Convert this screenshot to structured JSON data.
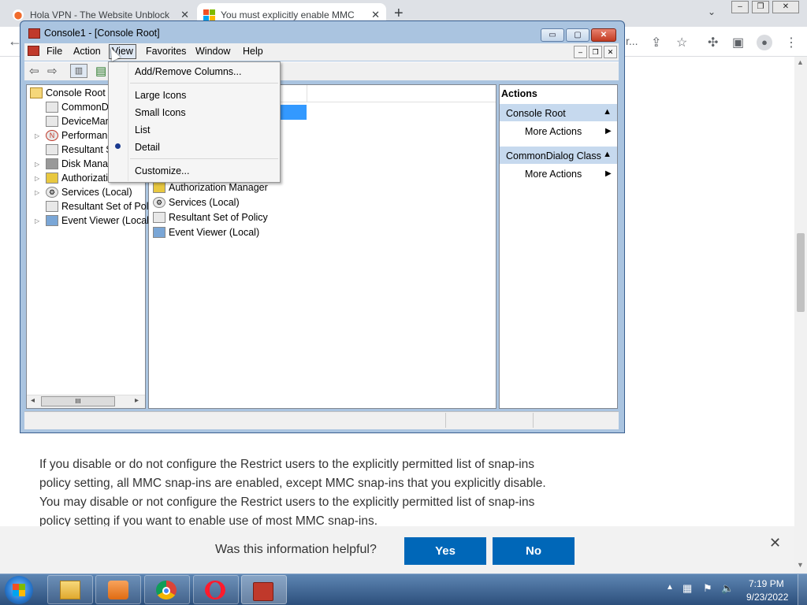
{
  "browser": {
    "tabs": [
      {
        "title": "Hola VPN - The Website Unblock",
        "close": "✕"
      },
      {
        "title": "You must explicitly enable MMC",
        "close": "✕"
      }
    ],
    "new_tab": "+",
    "tab_search": "⌄",
    "back": "←",
    "address_tail": "r...",
    "scroll_up": "▲",
    "scroll_down": "▼"
  },
  "article": {
    "paragraph_lines": [
      "If you disable or do not configure the Restrict users to the explicitly permitted list of snap-ins",
      "policy setting, all MMC snap-ins are enabled, except MMC snap-ins that you explicitly disable.",
      "You may disable or not configure the Restrict users to the explicitly permitted list of snap-ins",
      "policy setting if you want to enable use of most MMC snap-ins."
    ],
    "feedback": {
      "question": "Was this information helpful?",
      "yes": "Yes",
      "no": "No",
      "close": "✕"
    }
  },
  "mmc": {
    "title": "Console1 - [Console Root]",
    "window_buttons": {
      "minimize": "▭",
      "maximize": "▢",
      "close": "✕"
    },
    "mdi_buttons": {
      "minimize": "–",
      "restore": "❐",
      "close": "✕"
    },
    "menu": [
      "File",
      "Action",
      "View",
      "Favorites",
      "Window",
      "Help"
    ],
    "tree": {
      "root": "Console Root",
      "items": [
        {
          "label": "CommonD",
          "expandable": false
        },
        {
          "label": "DeviceMan",
          "expandable": false
        },
        {
          "label": "Performanc",
          "expandable": true
        },
        {
          "label": "Resultant S",
          "expandable": false
        },
        {
          "label": "Disk Manag",
          "expandable": true
        },
        {
          "label": "Authorizati",
          "expandable": true
        },
        {
          "label": "Services (Local)",
          "expandable": true
        },
        {
          "label": "Resultant Set of Poli",
          "expandable": false
        },
        {
          "label": "Event Viewer (Local)",
          "expandable": true
        }
      ],
      "scroll_left": "◂",
      "scroll_right": "▸",
      "scroll_grip": "III"
    },
    "center_items": [
      "Authorization Manager",
      "Services (Local)",
      "Resultant Set of Policy",
      "Event Viewer (Local)"
    ],
    "actions": {
      "header": "Actions",
      "sections": [
        {
          "title": "Console Root",
          "item": "More Actions"
        },
        {
          "title": "CommonDialog Class",
          "item": "More Actions"
        }
      ]
    },
    "view_menu": {
      "items": [
        "Add/Remove Columns...",
        "Large Icons",
        "Small Icons",
        "List",
        "Detail",
        "Customize..."
      ],
      "checked": "Detail"
    }
  },
  "taskbar": {
    "time": "7:19 PM",
    "date": "9/23/2022",
    "tray_arrow": "▲"
  },
  "colors": {
    "accent_blue": "#0067b8",
    "selection": "#3399ff",
    "action_section": "#c6d9ee"
  }
}
